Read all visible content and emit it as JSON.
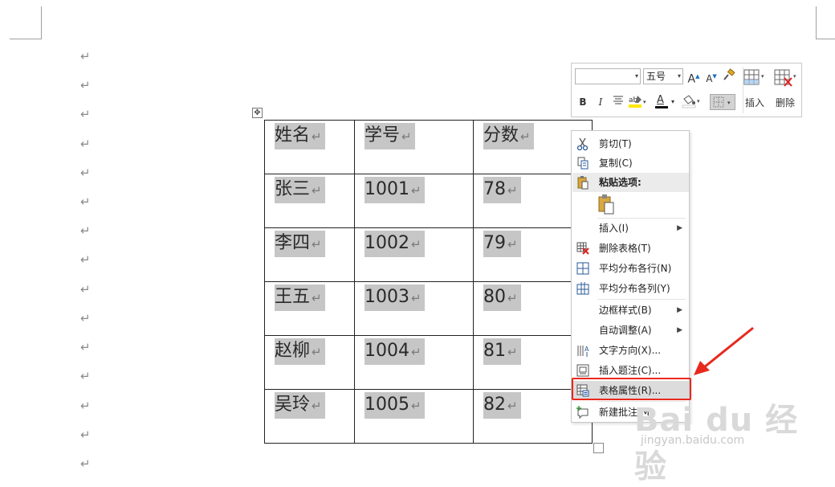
{
  "document": {
    "paragraph_mark": "↵",
    "table": {
      "headers": [
        "姓名",
        "学号",
        "分数"
      ],
      "rows": [
        [
          "张三",
          "1001",
          "78"
        ],
        [
          "李四",
          "1002",
          "79"
        ],
        [
          "王五",
          "1003",
          "80"
        ],
        [
          "赵柳",
          "1004",
          "81"
        ],
        [
          "吴玲",
          "1005",
          "82"
        ]
      ]
    }
  },
  "mini_toolbar": {
    "font_name": "",
    "font_size": "五号",
    "grow_font_icon": "A",
    "shrink_font_icon": "A",
    "bold": "B",
    "italic": "I",
    "font_color_icon": "A",
    "insert_label": "插入",
    "delete_label": "删除"
  },
  "context_menu": {
    "items": [
      {
        "label": "剪切(T)",
        "icon": "scissors-icon"
      },
      {
        "label": "复制(C)",
        "icon": "copy-icon"
      },
      {
        "label": "粘贴选项:",
        "icon": "paste-icon"
      },
      {
        "label": "插入(I)",
        "icon": "",
        "submenu": true
      },
      {
        "label": "删除表格(T)",
        "icon": "delete-table-icon"
      },
      {
        "label": "平均分布各行(N)",
        "icon": "distribute-rows-icon"
      },
      {
        "label": "平均分布各列(Y)",
        "icon": "distribute-columns-icon"
      },
      {
        "label": "边框样式(B)",
        "icon": "",
        "submenu": true
      },
      {
        "label": "自动调整(A)",
        "icon": "",
        "submenu": true
      },
      {
        "label": "文字方向(X)...",
        "icon": "text-direction-icon"
      },
      {
        "label": "插入题注(C)...",
        "icon": "insert-caption-icon"
      },
      {
        "label": "表格属性(R)...",
        "icon": "table-properties-icon"
      },
      {
        "label": "新建批注(M)",
        "icon": "new-comment-icon"
      }
    ],
    "submenu_arrow": "▶"
  },
  "watermark": {
    "brand": "Bai du 经验",
    "url": "jingyan.baidu.com"
  },
  "colors": {
    "highlight_box": "#e8291d",
    "arrow": "#e8291d",
    "cell_shading": "#c6c6c6"
  }
}
